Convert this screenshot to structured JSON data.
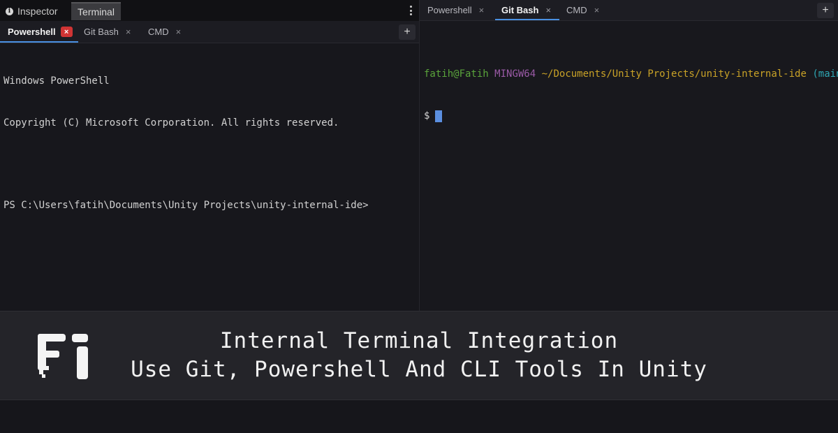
{
  "window_tabs": {
    "inspector_label": "Inspector",
    "terminal_label": "Terminal"
  },
  "left_terminal": {
    "tabs": [
      {
        "label": "Powershell",
        "active": true
      },
      {
        "label": "Git Bash",
        "active": false
      },
      {
        "label": "CMD",
        "active": false
      }
    ],
    "close_glyph": "×",
    "add_glyph": "+",
    "lines": [
      "Windows PowerShell",
      "Copyright (C) Microsoft Corporation. All rights reserved.",
      "",
      "PS C:\\Users\\fatih\\Documents\\Unity Projects\\unity-internal-ide>"
    ]
  },
  "right_terminal": {
    "tabs": [
      {
        "label": "Powershell",
        "active": false
      },
      {
        "label": "Git Bash",
        "active": true
      },
      {
        "label": "CMD",
        "active": false
      }
    ],
    "add_glyph": "+",
    "prompt": {
      "user_host": "fatih@Fatih",
      "system": "MINGW64",
      "path": "~/Documents/Unity Projects/unity-internal-ide",
      "branch": "(main)",
      "symbol": "$"
    }
  },
  "banner": {
    "title": "Internal Terminal Integration",
    "subtitle": "Use Git, Powershell And CLI Tools In Unity"
  },
  "colors": {
    "accent": "#4a90e2",
    "close_red": "#d03434",
    "prompt_green": "#5aa43b",
    "prompt_purple": "#9a5aa6",
    "prompt_yellow": "#c9a227",
    "prompt_cyan": "#2ea6b3"
  },
  "icons": {
    "info": "info-icon",
    "menu": "kebab-icon",
    "logo": "fi-logo"
  }
}
